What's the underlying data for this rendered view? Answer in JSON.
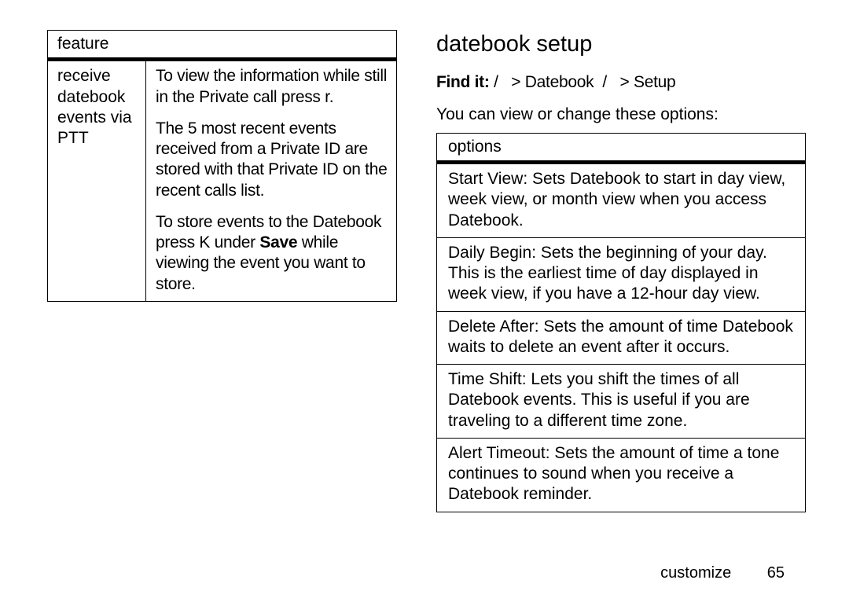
{
  "left": {
    "feature_header": "feature",
    "feature_name": "receive datebook events via PTT",
    "para1_a": "To view the information while still in the Private call press ",
    "para1_key": "r",
    "para1_b": ".",
    "para2": "The 5 most recent events received from a Private ID are stored with that Private ID on the recent calls list.",
    "para3_a": "To store events to the Datebook press ",
    "para3_key": "K",
    "para3_b": " under ",
    "para3_save": "Save",
    "para3_c": " while viewing the event you want to store."
  },
  "right": {
    "title": "datebook setup",
    "find_it_label": "Find it:",
    "find_sep": ">",
    "find_icon1": "/",
    "find_item1": "Datebook",
    "find_icon2": "/",
    "find_item2": "Setup",
    "intro": "You can view or change these options:",
    "options_header": "options",
    "options": [
      {
        "name": "Start View",
        "desc": "Sets Datebook to start in day view, week view, or month view when you access Datebook."
      },
      {
        "name": "Daily Begin",
        "desc": "Sets the beginning of your day. This is the earliest time of day displayed in week view, if you have a 12-hour day view."
      },
      {
        "name": "Delete After",
        "desc": "Sets the amount of time Datebook waits to delete an event after it occurs."
      },
      {
        "name": "Time Shift",
        "desc": "Lets you shift the times of all Datebook events. This is useful if you are traveling to a different time zone."
      },
      {
        "name": "Alert Timeout",
        "desc": "Sets the amount of time a tone continues to sound when you receive a Datebook reminder."
      }
    ]
  },
  "footer": {
    "section": "customize",
    "page": "65"
  }
}
